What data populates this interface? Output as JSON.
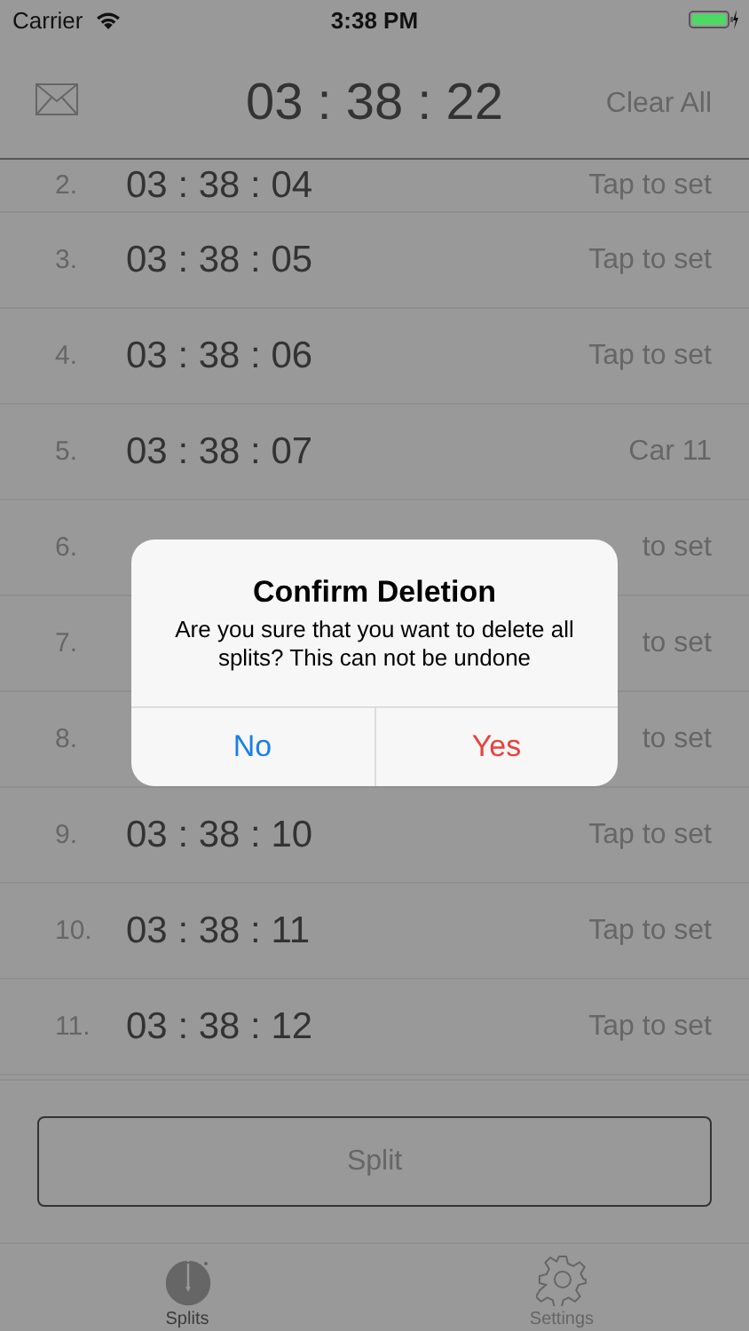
{
  "status_bar": {
    "carrier": "Carrier",
    "time": "3:38 PM"
  },
  "header": {
    "clock": "03 : 38 : 22",
    "clear_button": "Clear All"
  },
  "splits": [
    {
      "number": "2.",
      "time": "03 : 38 : 04",
      "label": "Tap to set"
    },
    {
      "number": "3.",
      "time": "03 : 38 : 05",
      "label": "Tap to set"
    },
    {
      "number": "4.",
      "time": "03 : 38 : 06",
      "label": "Tap to set"
    },
    {
      "number": "5.",
      "time": "03 : 38 : 07",
      "label": "Car 11"
    },
    {
      "number": "6.",
      "label": "to set"
    },
    {
      "number": "7.",
      "label": "to set"
    },
    {
      "number": "8.",
      "label": "to set"
    },
    {
      "number": "9.",
      "time": "03 : 38 : 10",
      "label": "Tap to set"
    },
    {
      "number": "10.",
      "time": "03 : 38 : 11",
      "label": "Tap to set"
    },
    {
      "number": "11.",
      "time": "03 : 38 : 12",
      "label": "Tap to set"
    }
  ],
  "split_button": "Split",
  "tabs": [
    {
      "label": "Splits",
      "kind": "stopwatch",
      "selected": true
    },
    {
      "label": "Settings",
      "kind": "gear",
      "selected": false
    }
  ],
  "alert": {
    "title": "Confirm Deletion",
    "message": "Are you sure that you want to delete all splits? This can not be undone",
    "buttons": [
      {
        "label": "No",
        "kind": "cancel"
      },
      {
        "label": "Yes",
        "kind": "destructive"
      }
    ]
  }
}
